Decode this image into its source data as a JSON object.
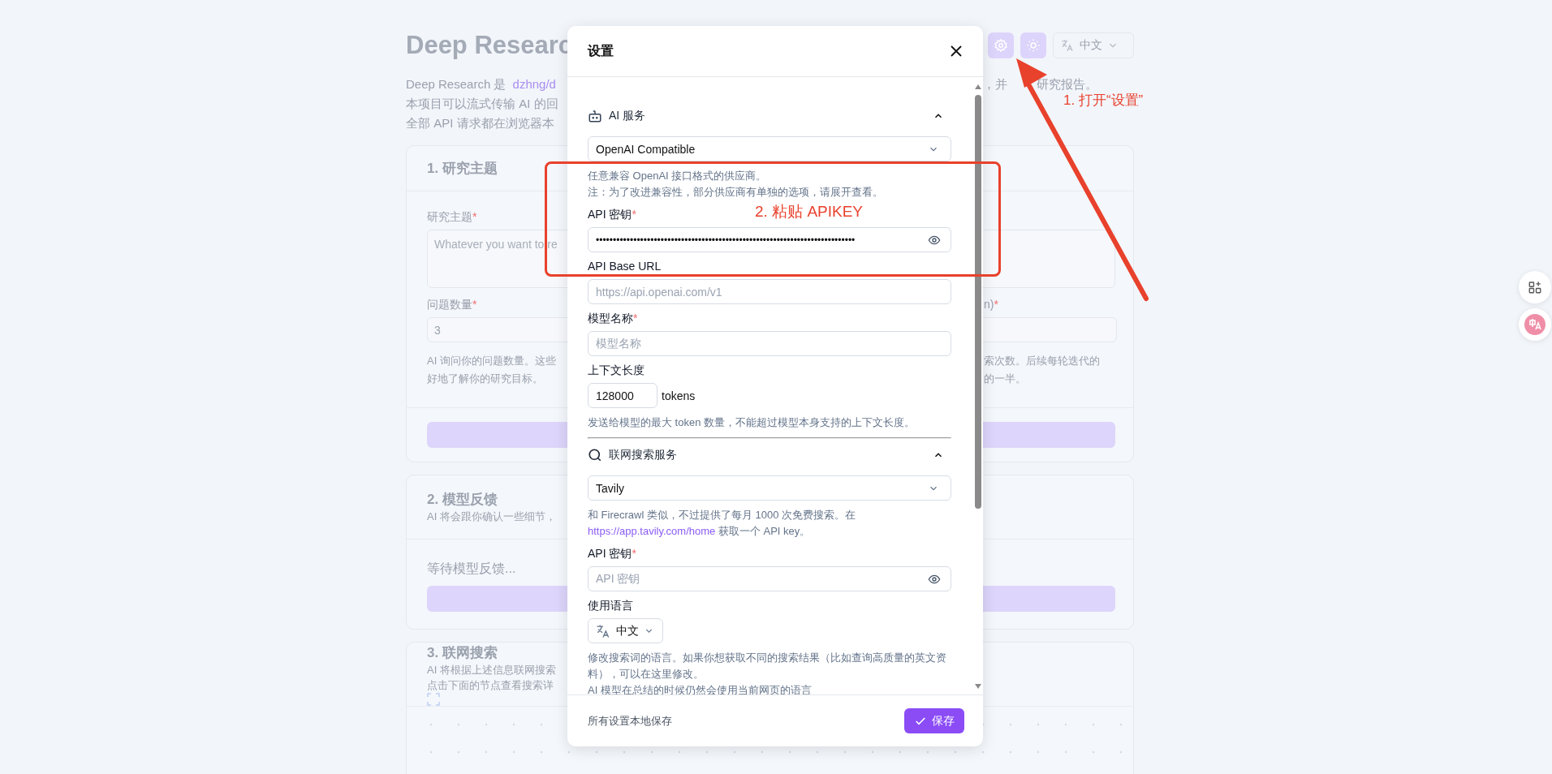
{
  "header": {
    "title": "Deep Researc",
    "language": "中文"
  },
  "intro": {
    "first_line": "Deep Research 是",
    "link": "dzhng/d",
    "lines": [
      "本项目可以流式传输 AI 的回",
      "全部 API 请求都在浏览器本"
    ],
    "right_text_start": "，并",
    "right_text_end": "研究报告。"
  },
  "research_card": {
    "title": "1. 研究主题",
    "topic_label": "研究主题",
    "topic_mark": "*",
    "topic_placeholder": "Whatever you want to re",
    "count_label": "问题数量",
    "count_mark": "*",
    "count_value": "3",
    "count_help": [
      "AI 询问你的问题数量。这些",
      "好地了解你的研究目标。"
    ],
    "right_label": "n)",
    "right_mark": "*",
    "right_help": [
      "索次数。后续每轮迭代的",
      "的一半。"
    ]
  },
  "feedback_card": {
    "title": "2. 模型反馈",
    "subtitle": "AI 将会跟你确认一些细节，",
    "status": "等待模型反馈..."
  },
  "search_card": {
    "title": "3. 联网搜索",
    "subtitle_lines": [
      "AI 将根据上述信息联网搜索",
      "点击下面的节点查看搜索详"
    ]
  },
  "settings_dialog": {
    "title": "设置",
    "sections": [
      {
        "kind": "ai",
        "title": "AI 服务",
        "expanded": true,
        "provider": "OpenAI Compatible",
        "help": [
          "任意兼容 OpenAI 接口格式的供应商。",
          "注：为了改进兼容性，部分供应商有单独的选项，请展开查看。"
        ],
        "fields": [
          {
            "kind": "password",
            "label": "API 密钥",
            "mark": "*",
            "value": "••••••••••••••••••••••••••••••••••••••••••••••••••••••••••••••••••••••••••••"
          },
          {
            "kind": "text",
            "label": "API Base URL",
            "placeholder": "https://api.openai.com/v1"
          },
          {
            "kind": "text",
            "label": "模型名称",
            "mark": "*",
            "placeholder": "模型名称"
          },
          {
            "kind": "number",
            "label": "上下文长度",
            "value": "128000",
            "suffix": "tokens",
            "help": [
              "发送给模型的最大 token 数量，不能超过模型本身支持的上下文长度。"
            ]
          }
        ]
      },
      {
        "kind": "search",
        "title": "联网搜索服务",
        "expanded": true,
        "provider": "Tavily",
        "help_before": "和 Firecrawl 类似，不过提供了每月 1000 次免费搜索。在",
        "help_link": "https://app.tavily.com/home",
        "help_after": " 获取一个 API key。",
        "fields": [
          {
            "kind": "password",
            "label": "API 密钥",
            "mark": "*",
            "placeholder": "API 密钥"
          },
          {
            "kind": "language",
            "label": "使用语言",
            "value": "中文",
            "help": [
              "修改搜索词的语言。如果你想获取不同的搜索结果（比如查询高质量的英文资料），可以在这里修改。",
              "AI 模型在总结的时候仍然会使用当前网页的语言"
            ]
          }
        ]
      }
    ],
    "footer_note": "所有设置本地保存",
    "save": "保存"
  },
  "annotations": [
    {
      "kind": "arrow-note",
      "text": "1. 打开“设置”"
    },
    {
      "kind": "box-note",
      "text": "2. 粘贴 APIKEY"
    }
  ]
}
